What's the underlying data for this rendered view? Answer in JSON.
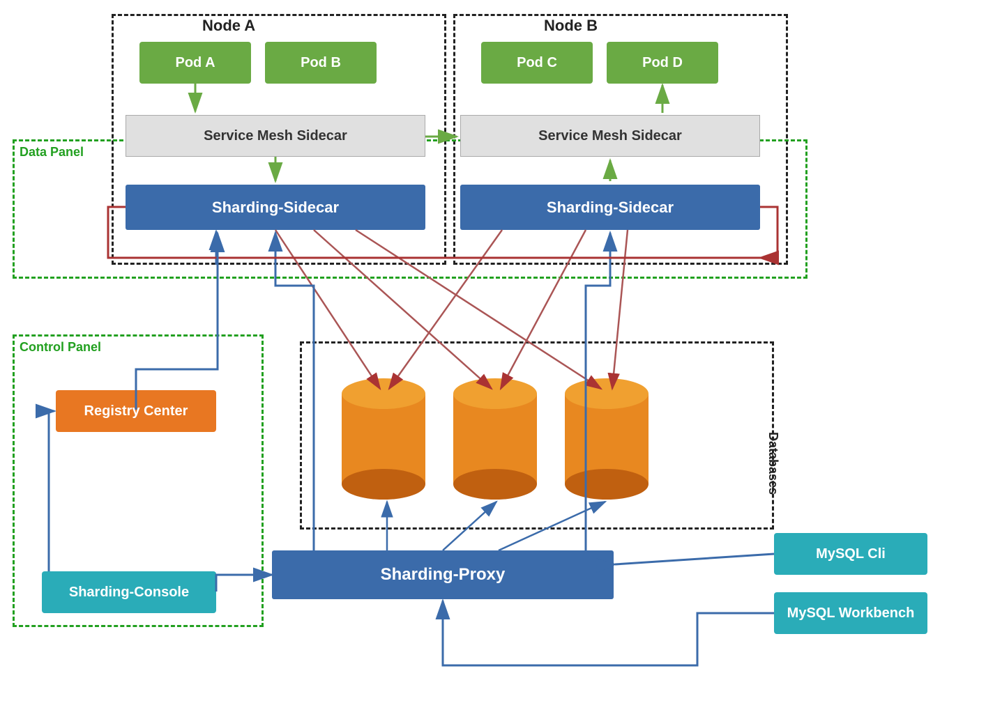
{
  "nodes": {
    "nodeA": {
      "label": "Node A"
    },
    "nodeB": {
      "label": "Node B"
    }
  },
  "pods": {
    "podA": {
      "label": "Pod A"
    },
    "podB": {
      "label": "Pod B"
    },
    "podC": {
      "label": "Pod C"
    },
    "podD": {
      "label": "Pod D"
    }
  },
  "sidecars": {
    "sidecarA": {
      "label": "Service Mesh Sidecar"
    },
    "sidecarB": {
      "label": "Service Mesh Sidecar"
    }
  },
  "shardingSidecars": {
    "sidecarA": {
      "label": "Sharding-Sidecar"
    },
    "sidecarB": {
      "label": "Sharding-Sidecar"
    }
  },
  "panels": {
    "dataPanel": {
      "label": "Data Panel"
    },
    "controlPanel": {
      "label": "Control Panel"
    },
    "databases": {
      "label": "Databases"
    }
  },
  "components": {
    "registryCenter": {
      "label": "Registry Center"
    },
    "shardingConsole": {
      "label": "Sharding-Console"
    },
    "shardingProxy": {
      "label": "Sharding-Proxy"
    },
    "mysqlCli": {
      "label": "MySQL Cli"
    },
    "mysqlWorkbench": {
      "label": "MySQL Workbench"
    }
  }
}
